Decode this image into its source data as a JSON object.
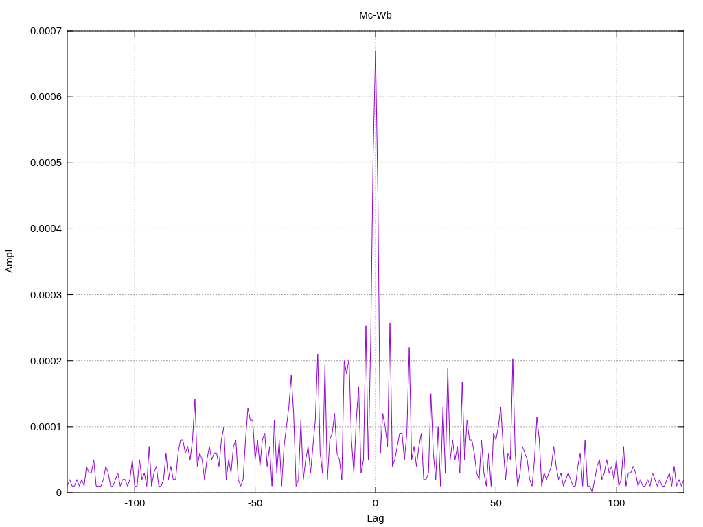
{
  "chart": {
    "chart_data": {
      "type": "line",
      "grid": true,
      "title": "Mc-Wb",
      "xlabel": "Lag",
      "ylabel": "Ampl",
      "xlim": [
        -128,
        128
      ],
      "ylim": [
        0,
        0.0007
      ],
      "xticks": [
        -100,
        -50,
        0,
        50,
        100
      ],
      "yticks": [
        0,
        0.0001,
        0.0002,
        0.0003,
        0.0004,
        0.0005,
        0.0006,
        0.0007
      ],
      "x": [
        -128,
        -127,
        -126,
        -125,
        -124,
        -123,
        -122,
        -121,
        -120,
        -119,
        -118,
        -117,
        -116,
        -115,
        -114,
        -113,
        -112,
        -111,
        -110,
        -109,
        -108,
        -107,
        -106,
        -105,
        -104,
        -103,
        -102,
        -101,
        -100,
        -99,
        -98,
        -97,
        -96,
        -95,
        -94,
        -93,
        -92,
        -91,
        -90,
        -89,
        -88,
        -87,
        -86,
        -85,
        -84,
        -83,
        -82,
        -81,
        -80,
        -79,
        -78,
        -77,
        -76,
        -75,
        -74,
        -73,
        -72,
        -71,
        -70,
        -69,
        -68,
        -67,
        -66,
        -65,
        -64,
        -63,
        -62,
        -61,
        -60,
        -59,
        -58,
        -57,
        -56,
        -55,
        -54,
        -53,
        -52,
        -51,
        -50,
        -49,
        -48,
        -47,
        -46,
        -45,
        -44,
        -43,
        -42,
        -41,
        -40,
        -39,
        -38,
        -37,
        -36,
        -35,
        -34,
        -33,
        -32,
        -31,
        -30,
        -29,
        -28,
        -27,
        -26,
        -25,
        -24,
        -23,
        -22,
        -21,
        -20,
        -19,
        -18,
        -17,
        -16,
        -15,
        -14,
        -13,
        -12,
        -11,
        -10,
        -9,
        -8,
        -7,
        -6,
        -5,
        -4,
        -3,
        -2,
        -1,
        0,
        1,
        2,
        3,
        4,
        5,
        6,
        7,
        8,
        9,
        10,
        11,
        12,
        13,
        14,
        15,
        16,
        17,
        18,
        19,
        20,
        21,
        22,
        23,
        24,
        25,
        26,
        27,
        28,
        29,
        30,
        31,
        32,
        33,
        34,
        35,
        36,
        37,
        38,
        39,
        40,
        41,
        42,
        43,
        44,
        45,
        46,
        47,
        48,
        49,
        50,
        51,
        52,
        53,
        54,
        55,
        56,
        57,
        58,
        59,
        60,
        61,
        62,
        63,
        64,
        65,
        66,
        67,
        68,
        69,
        70,
        71,
        72,
        73,
        74,
        75,
        76,
        77,
        78,
        79,
        80,
        81,
        82,
        83,
        84,
        85,
        86,
        87,
        88,
        89,
        90,
        91,
        92,
        93,
        94,
        95,
        96,
        97,
        98,
        99,
        100,
        101,
        102,
        103,
        104,
        105,
        106,
        107,
        108,
        109,
        110,
        111,
        112,
        113,
        114,
        115,
        116,
        117,
        118,
        119,
        120,
        121,
        122,
        123,
        124,
        125,
        126,
        127,
        128
      ],
      "series": [
        {
          "color": "#9400d3",
          "values": [
            1e-05,
            2e-05,
            1e-05,
            1e-05,
            2e-05,
            1e-05,
            2e-05,
            1e-05,
            4e-05,
            3e-05,
            3e-05,
            5e-05,
            1e-05,
            1e-05,
            1e-05,
            2e-05,
            4e-05,
            3e-05,
            1e-05,
            1e-05,
            2e-05,
            3e-05,
            1e-05,
            2e-05,
            2e-05,
            1e-05,
            2e-05,
            5e-05,
            1e-05,
            1e-05,
            5e-05,
            2e-05,
            3e-05,
            1e-05,
            7e-05,
            1e-05,
            3e-05,
            4e-05,
            1e-05,
            1e-05,
            2e-05,
            6e-05,
            2e-05,
            4e-05,
            2e-05,
            2e-05,
            6e-05,
            8e-05,
            8e-05,
            6e-05,
            7e-05,
            5e-05,
            8e-05,
            0.000142,
            4e-05,
            6e-05,
            5e-05,
            2e-05,
            5e-05,
            7e-05,
            5e-05,
            6e-05,
            6e-05,
            4e-05,
            8e-05,
            0.0001,
            2e-05,
            5e-05,
            3e-05,
            7e-05,
            8e-05,
            2e-05,
            1e-05,
            2e-05,
            8e-05,
            0.000128,
            0.00011,
            0.00011,
            5e-05,
            8e-05,
            4e-05,
            8e-05,
            9e-05,
            4e-05,
            7e-05,
            1e-05,
            0.00011,
            3e-05,
            8e-05,
            1e-05,
            7e-05,
            0.0001,
            0.00013,
            0.000178,
            0.00012,
            1e-05,
            2e-05,
            0.00011,
            2e-05,
            5e-05,
            7e-05,
            3e-05,
            7e-05,
            0.00011,
            0.00021,
            6e-05,
            3e-05,
            0.000194,
            2e-05,
            8e-05,
            9e-05,
            0.00012,
            6e-05,
            5e-05,
            2e-05,
            0.0002,
            0.00018,
            0.000203,
            8e-05,
            3e-05,
            0.00011,
            0.00016,
            3e-05,
            5e-05,
            0.000253,
            5e-05,
            0.00023,
            0.00051,
            0.00067,
            0.00045,
            6e-05,
            0.00012,
            0.0001,
            7e-05,
            0.000258,
            4e-05,
            5e-05,
            7e-05,
            9e-05,
            9e-05,
            5e-05,
            9e-05,
            0.00022,
            5e-05,
            7e-05,
            4e-05,
            7e-05,
            9e-05,
            2e-05,
            2e-05,
            3e-05,
            0.00015,
            6e-05,
            2e-05,
            0.0001,
            1e-05,
            0.00013,
            3e-05,
            0.000188,
            5e-05,
            8e-05,
            5e-05,
            7e-05,
            3e-05,
            0.000168,
            5e-05,
            0.00011,
            8e-05,
            8e-05,
            6e-05,
            3e-05,
            2e-05,
            8e-05,
            3e-05,
            1e-05,
            6e-05,
            1e-05,
            9e-05,
            8e-05,
            0.0001,
            0.00013,
            7e-05,
            2e-05,
            6e-05,
            5e-05,
            0.000203,
            6e-05,
            1e-05,
            3e-05,
            7e-05,
            6e-05,
            5e-05,
            2e-05,
            1e-05,
            5e-05,
            0.000115,
            8e-05,
            1e-05,
            3e-05,
            2e-05,
            3e-05,
            4e-05,
            7e-05,
            4e-05,
            2e-05,
            3e-05,
            1e-05,
            2e-05,
            3e-05,
            2e-05,
            1e-05,
            1e-05,
            4e-05,
            6e-05,
            1e-05,
            8e-05,
            1e-05,
            1e-05,
            0,
            2e-05,
            4e-05,
            5e-05,
            2e-05,
            3e-05,
            5e-05,
            3e-05,
            4e-05,
            2e-05,
            5e-05,
            1e-05,
            2e-05,
            7e-05,
            1e-05,
            3e-05,
            3e-05,
            4e-05,
            3e-05,
            1e-05,
            2e-05,
            1e-05,
            1e-05,
            2e-05,
            1e-05,
            3e-05,
            2e-05,
            1e-05,
            2e-05,
            1e-05,
            1e-05,
            2e-05,
            3e-05,
            1e-05,
            4e-05,
            1e-05,
            2e-05,
            1e-05,
            2e-05
          ]
        }
      ]
    }
  }
}
